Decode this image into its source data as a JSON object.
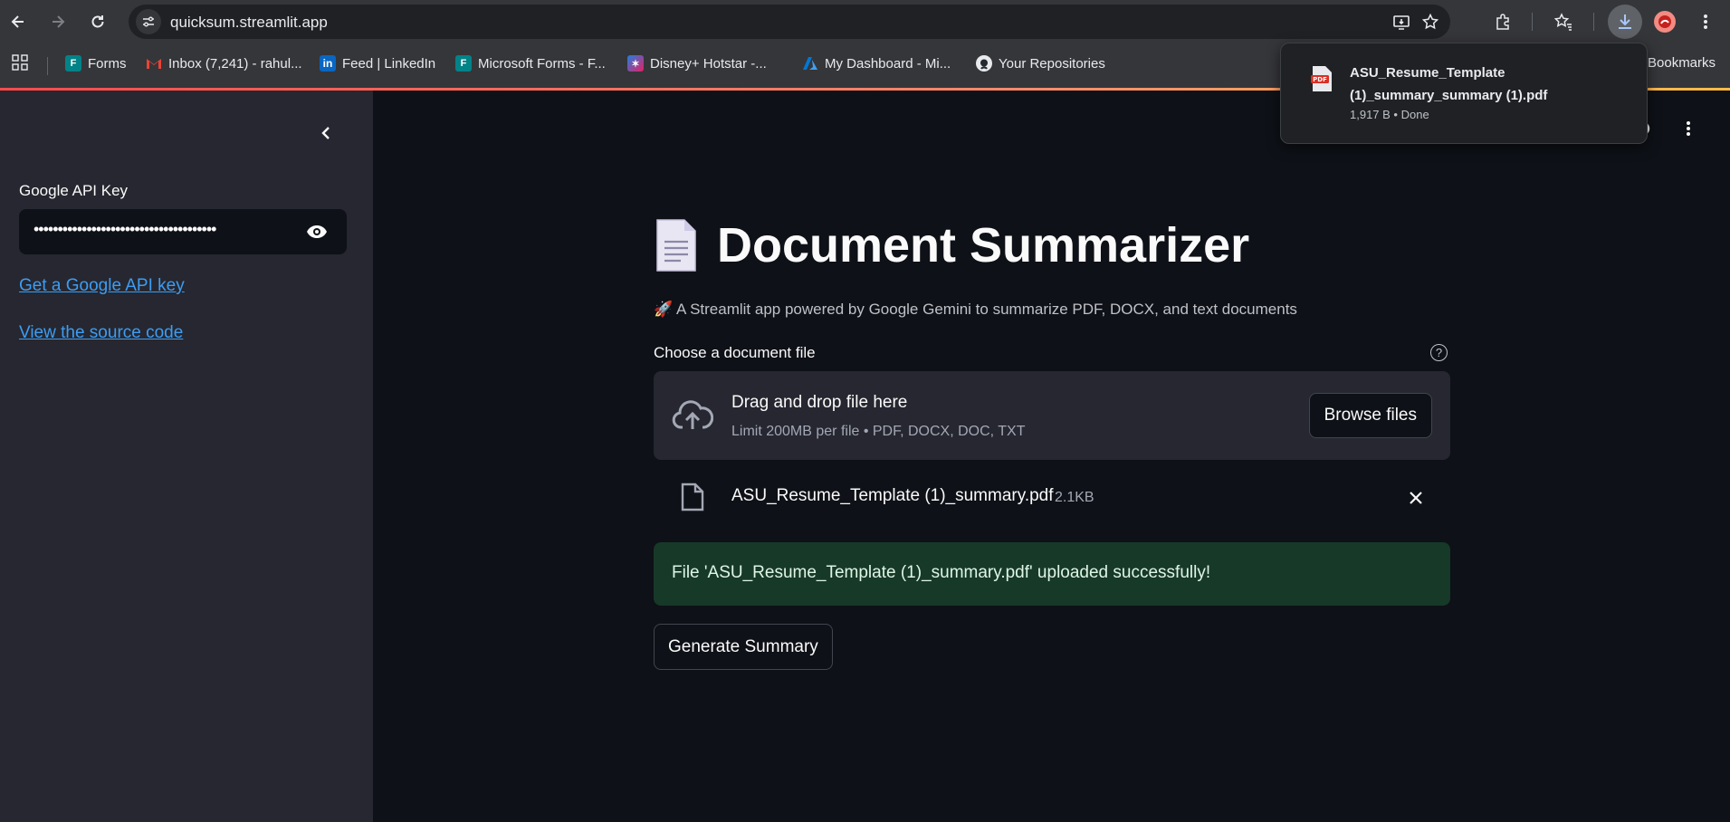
{
  "browser": {
    "url": "quicksum.streamlit.app",
    "bookmarks": [
      {
        "label": "Forms",
        "icon": "ms-forms-icon"
      },
      {
        "label": "Inbox (7,241) - rahul...",
        "icon": "gmail-icon"
      },
      {
        "label": "Feed | LinkedIn",
        "icon": "linkedin-icon"
      },
      {
        "label": "Microsoft Forms - F...",
        "icon": "ms-forms-icon"
      },
      {
        "label": "Disney+ Hotstar -...",
        "icon": "hotstar-icon"
      },
      {
        "label": "My Dashboard - Mi...",
        "icon": "azure-icon"
      },
      {
        "label": "Your Repositories",
        "icon": "github-icon"
      }
    ],
    "bookmarks_overflow": "Bookmarks",
    "download_popup": {
      "file_name": "ASU_Resume_Template (1)_summary_summary (1).pdf",
      "status": "1,917 B • Done",
      "icon_label": "PDF"
    }
  },
  "sidebar": {
    "api_key_label": "Google API Key",
    "api_key_value": "••••••••••••••••••••••••••••••••••••••",
    "links": [
      "Get a Google API key",
      "View the source code"
    ]
  },
  "main": {
    "title": "Document Summarizer",
    "subtitle": "🚀 A Streamlit app powered by Google Gemini to summarize PDF, DOCX, and text documents",
    "uploader_label": "Choose a document file",
    "help_icon_text": "?",
    "dropzone_title": "Drag and drop file here",
    "dropzone_limit": "Limit 200MB per file • PDF, DOCX, DOC, TXT",
    "browse_label": "Browse files",
    "uploaded_file": {
      "name": "ASU_Resume_Template (1)_summary.pdf",
      "size": "2.1KB"
    },
    "success_message": "File 'ASU_Resume_Template (1)_summary.pdf' uploaded successfully!",
    "generate_label": "Generate Summary"
  },
  "colors": {
    "accent": "#ff4b4b",
    "link": "#3d9df3",
    "success_bg": "#173928",
    "sidebar_bg": "#262730",
    "main_bg": "#0e1117"
  }
}
